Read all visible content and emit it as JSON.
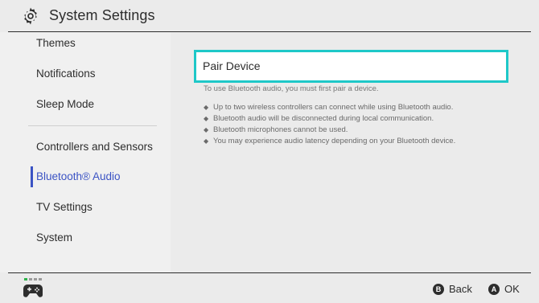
{
  "header": {
    "title": "System Settings",
    "icon": "gear-icon"
  },
  "sidebar": {
    "items": [
      {
        "label": "Themes"
      },
      {
        "label": "Notifications"
      },
      {
        "label": "Sleep Mode"
      },
      {
        "label": "Controllers and Sensors"
      },
      {
        "label": "Bluetooth® Audio",
        "active": true
      },
      {
        "label": "TV Settings"
      },
      {
        "label": "System"
      }
    ]
  },
  "main": {
    "pair_device_label": "Pair Device",
    "description": "To use Bluetooth audio, you must first pair a device.",
    "bullets": [
      "Up to two wireless controllers can connect while using Bluetooth audio.",
      "Bluetooth audio will be disconnected during local communication.",
      "Bluetooth microphones cannot be used.",
      "You may experience audio latency depending on your Bluetooth device."
    ],
    "bullet_glyph": "◆"
  },
  "footer": {
    "back_button_glyph": "B",
    "back_label": "Back",
    "ok_button_glyph": "A",
    "ok_label": "OK"
  },
  "colors": {
    "accent": "#3b53c4",
    "highlight": "#1ec8c8",
    "background": "#ebebeb",
    "sidebar": "#f0f0f0",
    "text": "#2d2d2d"
  }
}
